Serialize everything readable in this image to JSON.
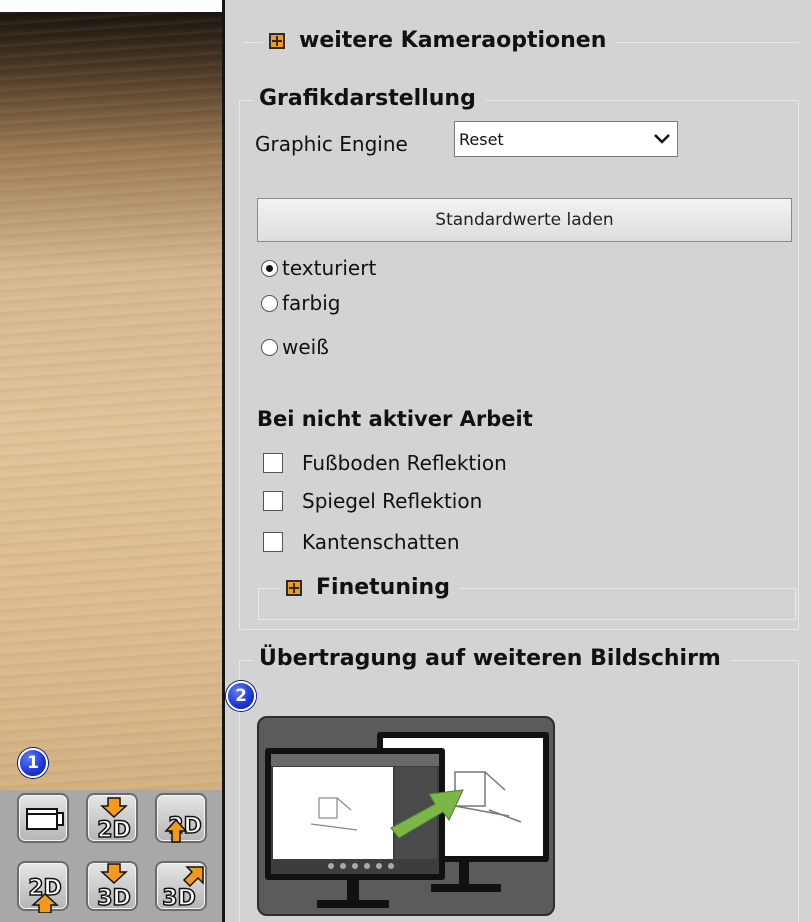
{
  "viewport": {
    "badge_1": "1",
    "view_buttons": [
      {
        "name": "camera-view-button",
        "label": ""
      },
      {
        "name": "2d-down-button",
        "label": "2D"
      },
      {
        "name": "2d-up-button",
        "label": "2D"
      },
      {
        "name": "2d-up-alt-button",
        "label": "2D"
      },
      {
        "name": "3d-down-button",
        "label": "3D"
      },
      {
        "name": "3d-up-button",
        "label": "3D"
      }
    ]
  },
  "panel": {
    "camera_options": {
      "label": "weitere Kameraoptionen",
      "icon": "expand-plus-icon"
    },
    "graphics": {
      "title": "Grafikdarstellung",
      "engine_label": "Graphic Engine",
      "engine_value": "Reset",
      "load_defaults_button": "Standardwerte laden",
      "modes": [
        {
          "label": "texturiert",
          "selected": true
        },
        {
          "label": "farbig",
          "selected": false
        },
        {
          "label": "weiß",
          "selected": false
        }
      ],
      "inactive_title": "Bei nicht aktiver Arbeit",
      "inactive_options": [
        {
          "label": "Fußboden Reflektion",
          "checked": false
        },
        {
          "label": "Spiegel Reflektion",
          "checked": false
        },
        {
          "label": "Kantenschatten",
          "checked": false
        }
      ],
      "finetuning": {
        "label": "Finetuning",
        "icon": "expand-plus-icon"
      }
    },
    "second_screen": {
      "title": "Übertragung auf weiteren Bildschirm",
      "badge_2": "2"
    }
  },
  "colors": {
    "panel_bg": "#d3d3d3",
    "accent_orange": "#f39a1c",
    "badge_blue": "#1a34d8",
    "arrow_green": "#7ab648"
  }
}
